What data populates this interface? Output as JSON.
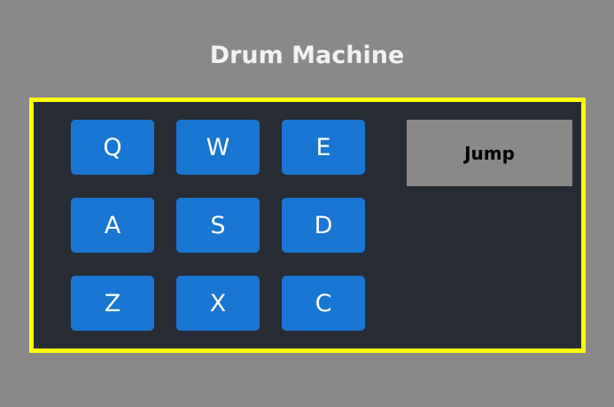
{
  "app": {
    "title": "Drum Machine"
  },
  "display": {
    "text": "Jump"
  },
  "pads": [
    {
      "key": "Q"
    },
    {
      "key": "W"
    },
    {
      "key": "E"
    },
    {
      "key": "A"
    },
    {
      "key": "S"
    },
    {
      "key": "D"
    },
    {
      "key": "Z"
    },
    {
      "key": "X"
    },
    {
      "key": "C"
    }
  ],
  "colors": {
    "background": "#8b8889",
    "machine_border": "#ffff00",
    "machine_background": "#282c35",
    "pad": "#1976d2",
    "pad_text": "#ffffff",
    "display_background": "#8b8889",
    "title_text": "#f2f2f2"
  }
}
